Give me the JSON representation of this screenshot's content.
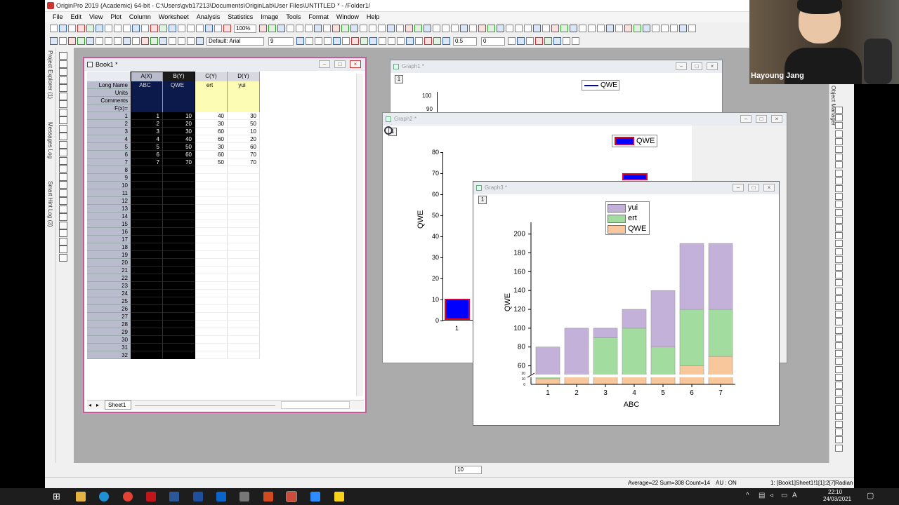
{
  "app": {
    "title": "OriginPro 2019 (Academic) 64-bit - C:\\Users\\gvb17213\\Documents\\OriginLab\\User Files\\UNTITLED * - /Folder1/",
    "menu": [
      "File",
      "Edit",
      "View",
      "Plot",
      "Column",
      "Worksheet",
      "Analysis",
      "Statistics",
      "Image",
      "Tools",
      "Format",
      "Window",
      "Help"
    ],
    "zoom": "100%",
    "font_combo": "Default: Arial",
    "font_size_combo": "9",
    "line_width_combo": "0.5",
    "angle_combo": "0",
    "bottom_size_combo": "10"
  },
  "left_dock": {
    "tabs": [
      "Project Explorer (1)",
      "Messages Log",
      "Smart Hint Log (3)"
    ]
  },
  "right_dock": {
    "tab": "Object Manager"
  },
  "book1": {
    "title": "Book1 *",
    "sheet_tab": "Sheet1",
    "columns": [
      "A(X)",
      "B(Y)",
      "C(Y)",
      "D(Y)"
    ],
    "row_labels": [
      "Long Name",
      "Units",
      "Comments",
      "F(x)="
    ],
    "long_names": [
      "ABC",
      "QWE",
      "ert",
      "yui"
    ],
    "row_count": 32,
    "rows": [
      [
        "1",
        "10",
        "40",
        "30"
      ],
      [
        "2",
        "20",
        "30",
        "50"
      ],
      [
        "3",
        "30",
        "60",
        "10"
      ],
      [
        "4",
        "40",
        "60",
        "20"
      ],
      [
        "5",
        "50",
        "30",
        "60"
      ],
      [
        "6",
        "60",
        "60",
        "70"
      ],
      [
        "7",
        "70",
        "50",
        "70"
      ]
    ]
  },
  "graph1": {
    "title": "Graph1 *",
    "layer": "1",
    "legend": "QWE",
    "visible_ticks": [
      "100",
      "90"
    ]
  },
  "graph2": {
    "title": "Graph2 *",
    "layer": "1",
    "legend": "QWE",
    "ylabel": "QWE",
    "yticks": [
      "80",
      "70",
      "60",
      "50",
      "40",
      "30",
      "20",
      "10",
      "0"
    ],
    "xtick": "1",
    "bar_value": 10
  },
  "graph3": {
    "title": "Graph3 *",
    "layer": "1",
    "chart_data": {
      "type": "bar",
      "stacked": true,
      "categories": [
        "1",
        "2",
        "3",
        "4",
        "5",
        "6",
        "7"
      ],
      "series": [
        {
          "name": "QWE",
          "values": [
            10,
            20,
            30,
            40,
            50,
            60,
            70
          ],
          "color": "#f9c79c"
        },
        {
          "name": "ert",
          "values": [
            40,
            30,
            60,
            60,
            30,
            60,
            50
          ],
          "color": "#a3dc9f"
        },
        {
          "name": "yui",
          "values": [
            30,
            50,
            10,
            20,
            60,
            70,
            70
          ],
          "color": "#c4b1d9"
        }
      ],
      "legend_order": [
        "yui",
        "ert",
        "QWE"
      ],
      "xlabel": "ABC",
      "ylabel": "QWE",
      "yticks_upper": [
        "200",
        "180",
        "160",
        "140",
        "120",
        "100",
        "80",
        "60"
      ],
      "yticks_lower": [
        "20",
        "10",
        "0"
      ],
      "axis_break": true,
      "ylim_upper": [
        50,
        205
      ],
      "ylim_lower": [
        0,
        21
      ]
    }
  },
  "status": {
    "stats": "Average=22 Sum=308 Count=14",
    "au": "AU : ON",
    "selection": "1: [Book1]Sheet1!1[1]:2[7]",
    "unit": "Radian"
  },
  "webcam": {
    "name": "Hayoung Jang"
  },
  "clock": {
    "time": "22:10",
    "date": "24/03/2021"
  }
}
